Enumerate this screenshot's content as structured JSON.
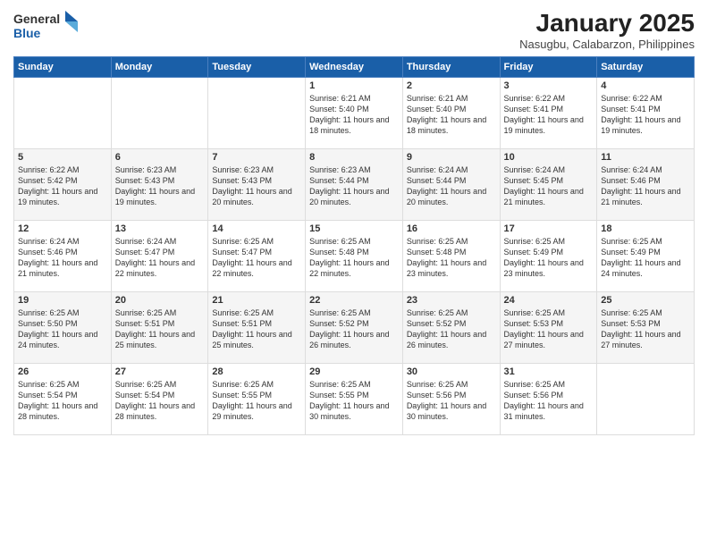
{
  "logo": {
    "general": "General",
    "blue": "Blue"
  },
  "title": {
    "month": "January 2025",
    "location": "Nasugbu, Calabarzon, Philippines"
  },
  "weekdays": [
    "Sunday",
    "Monday",
    "Tuesday",
    "Wednesday",
    "Thursday",
    "Friday",
    "Saturday"
  ],
  "weeks": [
    [
      {
        "day": "",
        "info": ""
      },
      {
        "day": "",
        "info": ""
      },
      {
        "day": "",
        "info": ""
      },
      {
        "day": "1",
        "info": "Sunrise: 6:21 AM\nSunset: 5:40 PM\nDaylight: 11 hours and 18 minutes."
      },
      {
        "day": "2",
        "info": "Sunrise: 6:21 AM\nSunset: 5:40 PM\nDaylight: 11 hours and 18 minutes."
      },
      {
        "day": "3",
        "info": "Sunrise: 6:22 AM\nSunset: 5:41 PM\nDaylight: 11 hours and 19 minutes."
      },
      {
        "day": "4",
        "info": "Sunrise: 6:22 AM\nSunset: 5:41 PM\nDaylight: 11 hours and 19 minutes."
      }
    ],
    [
      {
        "day": "5",
        "info": "Sunrise: 6:22 AM\nSunset: 5:42 PM\nDaylight: 11 hours and 19 minutes."
      },
      {
        "day": "6",
        "info": "Sunrise: 6:23 AM\nSunset: 5:43 PM\nDaylight: 11 hours and 19 minutes."
      },
      {
        "day": "7",
        "info": "Sunrise: 6:23 AM\nSunset: 5:43 PM\nDaylight: 11 hours and 20 minutes."
      },
      {
        "day": "8",
        "info": "Sunrise: 6:23 AM\nSunset: 5:44 PM\nDaylight: 11 hours and 20 minutes."
      },
      {
        "day": "9",
        "info": "Sunrise: 6:24 AM\nSunset: 5:44 PM\nDaylight: 11 hours and 20 minutes."
      },
      {
        "day": "10",
        "info": "Sunrise: 6:24 AM\nSunset: 5:45 PM\nDaylight: 11 hours and 21 minutes."
      },
      {
        "day": "11",
        "info": "Sunrise: 6:24 AM\nSunset: 5:46 PM\nDaylight: 11 hours and 21 minutes."
      }
    ],
    [
      {
        "day": "12",
        "info": "Sunrise: 6:24 AM\nSunset: 5:46 PM\nDaylight: 11 hours and 21 minutes."
      },
      {
        "day": "13",
        "info": "Sunrise: 6:24 AM\nSunset: 5:47 PM\nDaylight: 11 hours and 22 minutes."
      },
      {
        "day": "14",
        "info": "Sunrise: 6:25 AM\nSunset: 5:47 PM\nDaylight: 11 hours and 22 minutes."
      },
      {
        "day": "15",
        "info": "Sunrise: 6:25 AM\nSunset: 5:48 PM\nDaylight: 11 hours and 22 minutes."
      },
      {
        "day": "16",
        "info": "Sunrise: 6:25 AM\nSunset: 5:48 PM\nDaylight: 11 hours and 23 minutes."
      },
      {
        "day": "17",
        "info": "Sunrise: 6:25 AM\nSunset: 5:49 PM\nDaylight: 11 hours and 23 minutes."
      },
      {
        "day": "18",
        "info": "Sunrise: 6:25 AM\nSunset: 5:49 PM\nDaylight: 11 hours and 24 minutes."
      }
    ],
    [
      {
        "day": "19",
        "info": "Sunrise: 6:25 AM\nSunset: 5:50 PM\nDaylight: 11 hours and 24 minutes."
      },
      {
        "day": "20",
        "info": "Sunrise: 6:25 AM\nSunset: 5:51 PM\nDaylight: 11 hours and 25 minutes."
      },
      {
        "day": "21",
        "info": "Sunrise: 6:25 AM\nSunset: 5:51 PM\nDaylight: 11 hours and 25 minutes."
      },
      {
        "day": "22",
        "info": "Sunrise: 6:25 AM\nSunset: 5:52 PM\nDaylight: 11 hours and 26 minutes."
      },
      {
        "day": "23",
        "info": "Sunrise: 6:25 AM\nSunset: 5:52 PM\nDaylight: 11 hours and 26 minutes."
      },
      {
        "day": "24",
        "info": "Sunrise: 6:25 AM\nSunset: 5:53 PM\nDaylight: 11 hours and 27 minutes."
      },
      {
        "day": "25",
        "info": "Sunrise: 6:25 AM\nSunset: 5:53 PM\nDaylight: 11 hours and 27 minutes."
      }
    ],
    [
      {
        "day": "26",
        "info": "Sunrise: 6:25 AM\nSunset: 5:54 PM\nDaylight: 11 hours and 28 minutes."
      },
      {
        "day": "27",
        "info": "Sunrise: 6:25 AM\nSunset: 5:54 PM\nDaylight: 11 hours and 28 minutes."
      },
      {
        "day": "28",
        "info": "Sunrise: 6:25 AM\nSunset: 5:55 PM\nDaylight: 11 hours and 29 minutes."
      },
      {
        "day": "29",
        "info": "Sunrise: 6:25 AM\nSunset: 5:55 PM\nDaylight: 11 hours and 30 minutes."
      },
      {
        "day": "30",
        "info": "Sunrise: 6:25 AM\nSunset: 5:56 PM\nDaylight: 11 hours and 30 minutes."
      },
      {
        "day": "31",
        "info": "Sunrise: 6:25 AM\nSunset: 5:56 PM\nDaylight: 11 hours and 31 minutes."
      },
      {
        "day": "",
        "info": ""
      }
    ]
  ]
}
